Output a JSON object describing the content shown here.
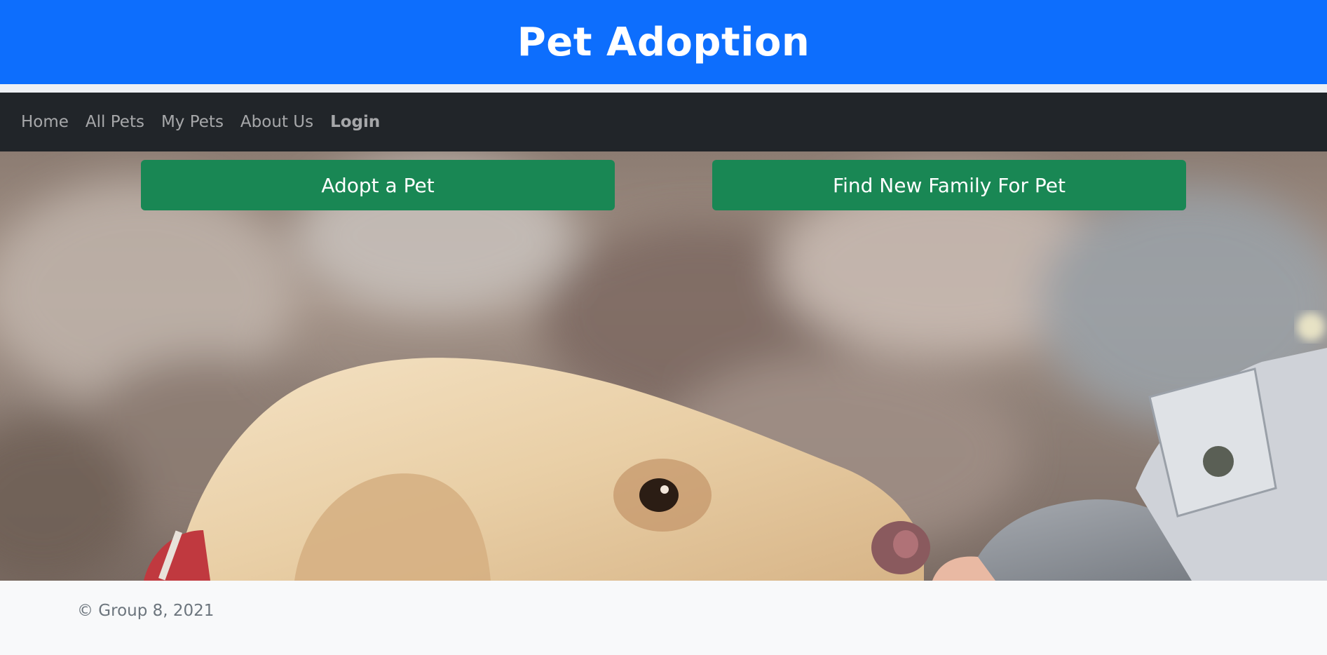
{
  "header": {
    "title": "Pet Adoption"
  },
  "nav": {
    "items": [
      {
        "label": "Home"
      },
      {
        "label": "All Pets"
      },
      {
        "label": "My Pets"
      },
      {
        "label": "About Us"
      },
      {
        "label": "Login"
      }
    ]
  },
  "hero": {
    "adopt_label": "Adopt a Pet",
    "rehome_label": "Find New Family For Pet"
  },
  "footer": {
    "copyright": "© Group 8, 2021"
  },
  "colors": {
    "header_bg": "#0d6efd",
    "navbar_bg": "#212529",
    "button_bg": "#198754",
    "footer_bg": "#f8f9fa"
  }
}
